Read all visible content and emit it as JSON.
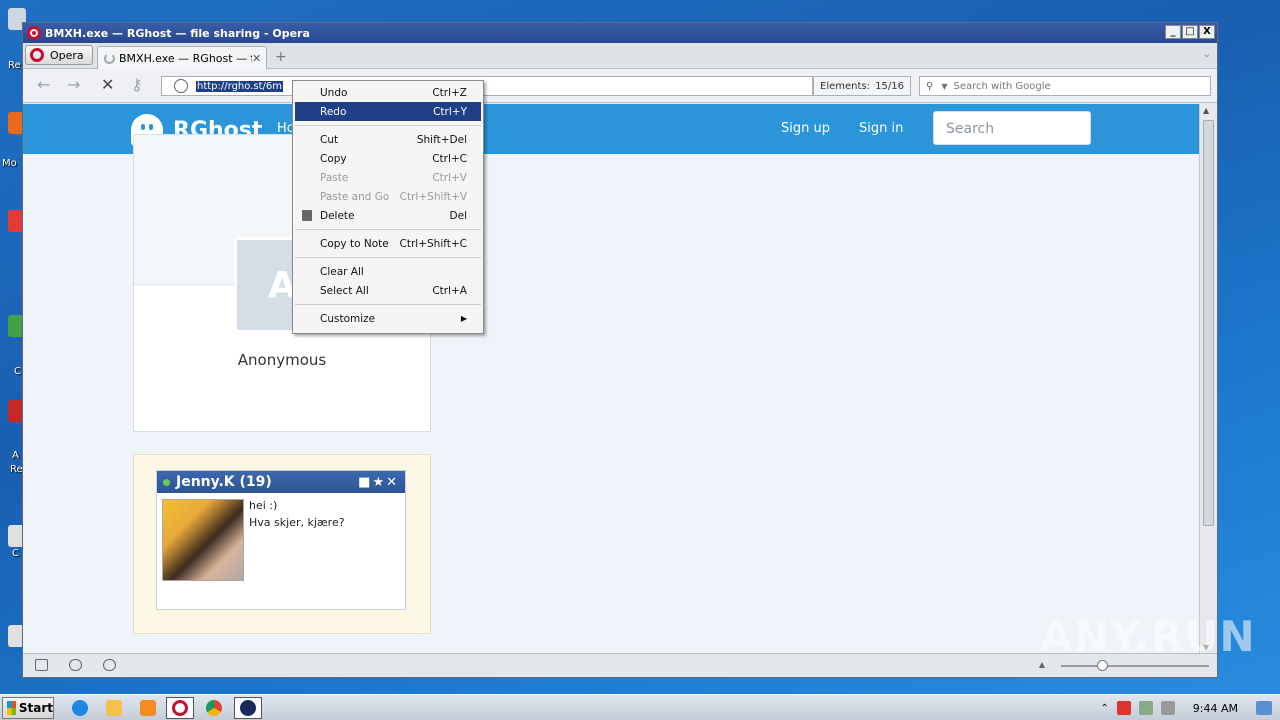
{
  "desktop": {
    "labels": [
      "Re",
      "Mo",
      "C",
      "A",
      "Re",
      "C"
    ]
  },
  "window": {
    "title": "BMXH.exe — RGhost — file sharing - Opera",
    "buttons": {
      "minimize": "_",
      "maximize": "□",
      "close": "X"
    }
  },
  "tabs": {
    "opera_menu_label": "Opera",
    "active_tab_title": "BMXH.exe — RGhost — f…",
    "close_glyph": "✕",
    "new_tab_glyph": "+",
    "tab_menu_glyph": "⌄"
  },
  "toolbar": {
    "back_glyph": "←",
    "forward_glyph": "→",
    "stop_glyph": "✕",
    "key_glyph": "⚷",
    "url": "http://rgho.st/6m",
    "elements_label": "Elements:",
    "elements_value": "15/16",
    "search_placeholder": "Search with Google"
  },
  "site": {
    "brand": "RGhost",
    "home_link_partial": "Ho",
    "signup": "Sign up",
    "signin": "Sign in",
    "search_placeholder": "Search",
    "avatar_letter": "A",
    "user_name": "Anonymous"
  },
  "ad": {
    "chat_title": "Jenny.K (19)",
    "chat_icons": "■★✕",
    "line1": "hei :)",
    "line2": "Hva skjer, kjære?"
  },
  "context_menu": {
    "items": [
      {
        "label": "Undo",
        "shortcut": "Ctrl+Z"
      },
      {
        "label": "Redo",
        "shortcut": "Ctrl+Y"
      },
      {
        "label": "Cut",
        "shortcut": "Shift+Del"
      },
      {
        "label": "Copy",
        "shortcut": "Ctrl+C"
      },
      {
        "label": "Paste",
        "shortcut": "Ctrl+V"
      },
      {
        "label": "Paste and Go",
        "shortcut": "Ctrl+Shift+V"
      },
      {
        "label": "Delete",
        "shortcut": "Del"
      },
      {
        "label": "Copy to Note",
        "shortcut": "Ctrl+Shift+C"
      },
      {
        "label": "Clear All",
        "shortcut": ""
      },
      {
        "label": "Select All",
        "shortcut": "Ctrl+A"
      },
      {
        "label": "Customize",
        "shortcut": ""
      }
    ],
    "highlighted": "Redo",
    "disabled": [
      "Paste",
      "Paste and Go"
    ]
  },
  "taskbar": {
    "start_label": "Start",
    "clock": "9:44 AM"
  },
  "watermark": "ANY.RUN",
  "colors": {
    "site_header": "#2a96d9",
    "menu_highlight": "#1f3f86",
    "titlebar": "#28488e"
  }
}
